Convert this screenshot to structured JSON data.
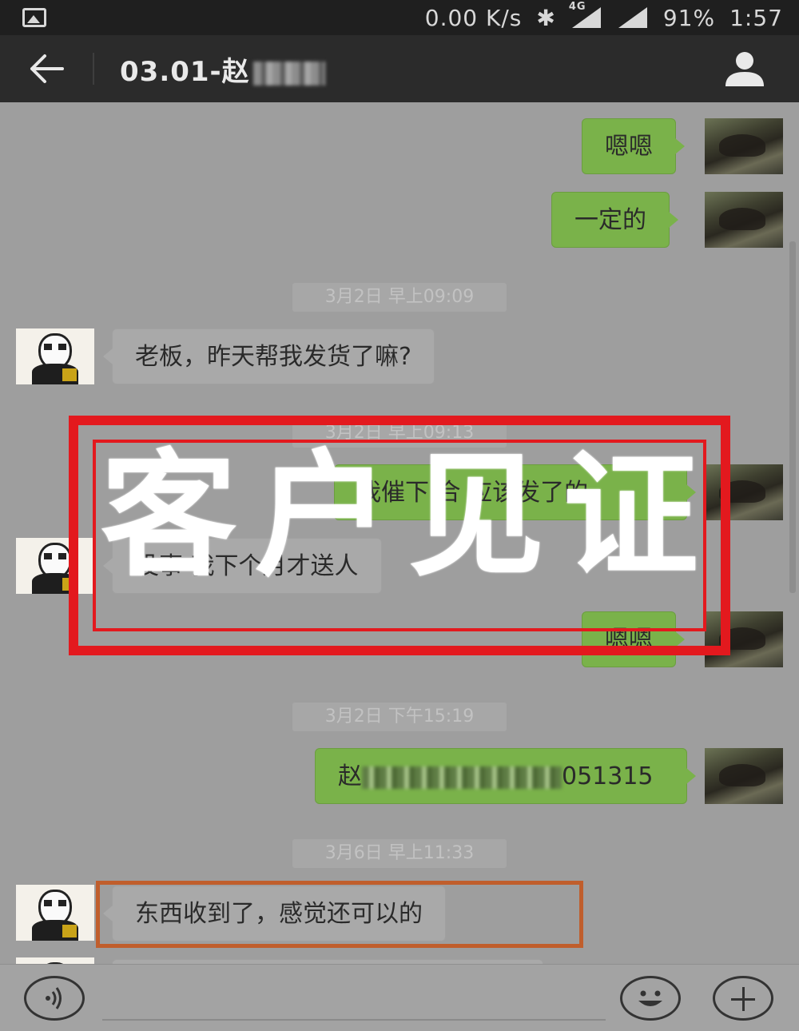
{
  "status_bar": {
    "network_speed": "0.00 K/s",
    "bluetooth_icon": "bluetooth-icon",
    "network_type": "4G",
    "battery": "91%",
    "time": "1:57"
  },
  "header": {
    "title_visible": "03.01-赵",
    "title_blurred": true,
    "back_icon": "arrow-left-icon",
    "profile_icon": "person-icon"
  },
  "messages": [
    {
      "type": "out",
      "text": "嗯嗯"
    },
    {
      "type": "out",
      "text": "一定的"
    },
    {
      "type": "time",
      "text": "3月2日 早上09:09"
    },
    {
      "type": "in",
      "text": "老板，昨天帮我发货了嘛?"
    },
    {
      "type": "time",
      "text": "3月2日 早上09:13"
    },
    {
      "type": "out",
      "text": "我催下 合 应该发了的"
    },
    {
      "type": "in",
      "text": "没事 我下个月才送人"
    },
    {
      "type": "out",
      "text": "嗯嗯"
    },
    {
      "type": "time",
      "text": "3月2日 下午15:19"
    },
    {
      "type": "out",
      "text_prefix": "赵",
      "text_suffix": "051315",
      "blurred": true
    },
    {
      "type": "time",
      "text": "3月6日 早上11:33"
    },
    {
      "type": "in",
      "text": "东西收到了，感觉还可以的",
      "highlighted": true
    }
  ],
  "watermark": {
    "text": [
      "客",
      "户",
      "见",
      "证"
    ],
    "color": "#e3191e"
  },
  "input_bar": {
    "voice_icon": "voice-icon",
    "emoji_icon": "smiley-icon",
    "more_icon": "plus-icon"
  },
  "colors": {
    "outgoing_bubble": "#7ab24a",
    "highlight_border": "#c05e2c"
  }
}
